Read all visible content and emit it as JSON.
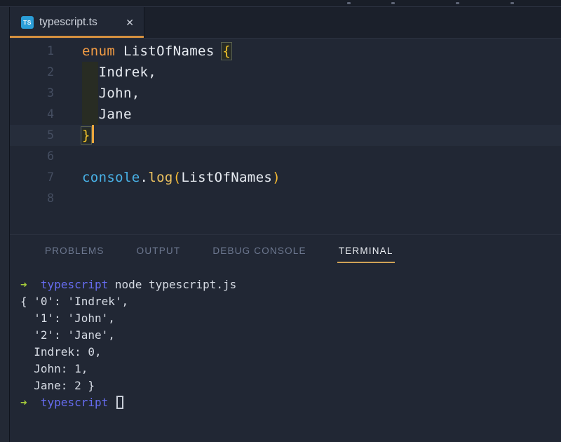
{
  "colors": {
    "titlebar_bg": "#191e28",
    "tabbar_bg": "#1b202b",
    "editor_bg": "#212734",
    "sidebar_bg": "#232935",
    "border_color": "#2b3140",
    "tab_label": "#ced3dc",
    "ts_icon_bg": "#2b9ed8",
    "tab_underline": "#d4903f",
    "line_number": "#454e61",
    "editor_line_highlight": "#262d3b",
    "cursor_orange": "#eda73e",
    "keyword": "#f29c44",
    "code_plain": "#e7ebf1",
    "brace": "#f5c62b",
    "support_class": "#48b1e6",
    "func": "#edc25f",
    "paren": "#f8bc33",
    "panel_tab_inactive": "#6d7890",
    "panel_tab_active": "#e9ecf1",
    "terminal_underline": "#cfa256",
    "terminal_text": "#d6dbe4",
    "prompt_arrow": "#a6cc3b",
    "prompt_dir": "#666cf0",
    "terminal_cursor_border": "#c8cdd7"
  },
  "tab_bar": {
    "tabs": [
      {
        "label": "typescript.ts",
        "icon_text": "TS",
        "close_glyph": "✕",
        "active": true
      }
    ]
  },
  "editor": {
    "current_line": 5,
    "cursor_line": 5,
    "lines": [
      {
        "num": 1,
        "segments": [
          {
            "style": "keyword",
            "text": "enum"
          },
          {
            "style": "plain",
            "text": " ListOfNames "
          },
          {
            "style": "brace",
            "text": "{"
          }
        ]
      },
      {
        "num": 2,
        "segments": [
          {
            "style": "plain",
            "text": "  Indrek,"
          }
        ]
      },
      {
        "num": 3,
        "segments": [
          {
            "style": "plain",
            "text": "  John,"
          }
        ]
      },
      {
        "num": 4,
        "segments": [
          {
            "style": "plain",
            "text": "  Jane"
          }
        ]
      },
      {
        "num": 5,
        "segments": [
          {
            "style": "brace",
            "text": "}"
          }
        ]
      },
      {
        "num": 6,
        "segments": []
      },
      {
        "num": 7,
        "segments": [
          {
            "style": "support",
            "text": "console"
          },
          {
            "style": "plain",
            "text": "."
          },
          {
            "style": "func",
            "text": "log"
          },
          {
            "style": "paren",
            "text": "("
          },
          {
            "style": "plain",
            "text": "ListOfNames"
          },
          {
            "style": "paren",
            "text": ")"
          }
        ]
      },
      {
        "num": 8,
        "segments": []
      }
    ]
  },
  "panel": {
    "tabs": [
      {
        "label": "PROBLEMS",
        "active": false
      },
      {
        "label": "OUTPUT",
        "active": false
      },
      {
        "label": "DEBUG CONSOLE",
        "active": false
      },
      {
        "label": "TERMINAL",
        "active": true
      }
    ]
  },
  "terminal": {
    "lines": [
      {
        "segments": [
          {
            "style": "arrow",
            "text": "➜"
          },
          {
            "style": "plain",
            "text": "  "
          },
          {
            "style": "dir",
            "text": "typescript"
          },
          {
            "style": "plain",
            "text": " node typescript.js"
          }
        ]
      },
      {
        "segments": [
          {
            "style": "plain",
            "text": "{ '0': 'Indrek',"
          }
        ]
      },
      {
        "segments": [
          {
            "style": "plain",
            "text": "  '1': 'John',"
          }
        ]
      },
      {
        "segments": [
          {
            "style": "plain",
            "text": "  '2': 'Jane',"
          }
        ]
      },
      {
        "segments": [
          {
            "style": "plain",
            "text": "  Indrek: 0,"
          }
        ]
      },
      {
        "segments": [
          {
            "style": "plain",
            "text": "  John: 1,"
          }
        ]
      },
      {
        "segments": [
          {
            "style": "plain",
            "text": "  Jane: 2 }"
          }
        ]
      },
      {
        "segments": [
          {
            "style": "arrow",
            "text": "➜"
          },
          {
            "style": "plain",
            "text": "  "
          },
          {
            "style": "dir",
            "text": "typescript"
          },
          {
            "style": "plain",
            "text": " "
          },
          {
            "style": "cursor",
            "text": ""
          }
        ]
      }
    ]
  }
}
